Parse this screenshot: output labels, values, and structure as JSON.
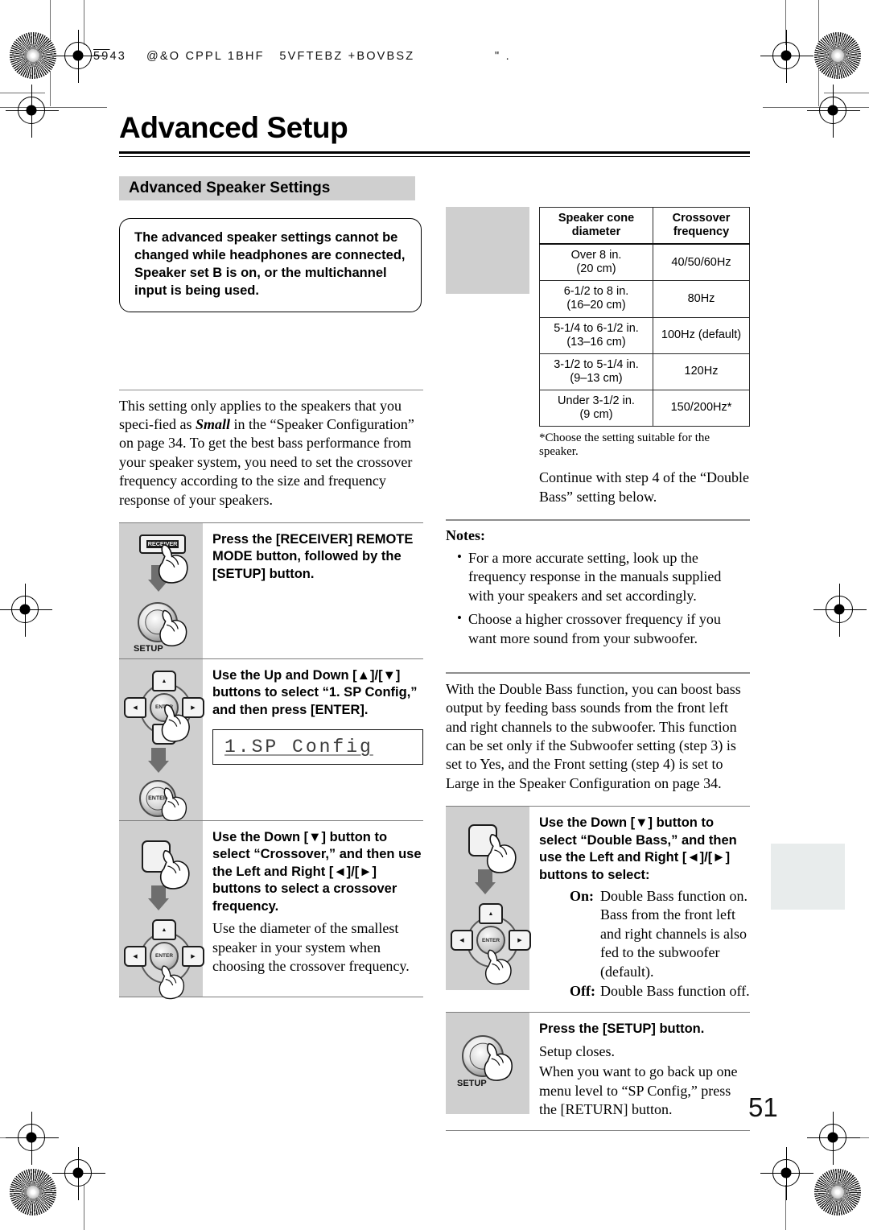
{
  "runhead": {
    "page_code": "59",
    "rest": "43    @&O CPPL 1BHF   5VFTEBZ +BOVBSZ                \" ."
  },
  "title": "Advanced Setup",
  "section": {
    "heading": "Advanced Speaker Settings"
  },
  "notice": {
    "text": "The advanced speaker settings cannot be changed while headphones are connected, Speaker set B is on, or the multichannel input is being used."
  },
  "intro": "This setting only applies to the speakers that you specified as Small in the “Speaker Configuration” on page 34. To get the best bass performance from your speaker system, you need to set the crossover frequency according to the size and frequency response of your speakers.",
  "left_steps": [
    {
      "heading": "Press the [RECEIVER] REMOTE MODE button, followed by the [SETUP] button.",
      "sub": "",
      "icons": [
        "receiver-button",
        "down-arrow",
        "setup-knob"
      ],
      "receiver_label": "RECEIVER",
      "setup_label": "SETUP"
    },
    {
      "heading": "Use the Up and Down [▲]/[▼] buttons to select “1. SP Config,” and then press [ENTER].",
      "sub": "",
      "lcd": "1.SP Config",
      "enter_label": "ENTER"
    },
    {
      "heading": "Use the Down [▼] button to select “Crossover,” and then use the Left and Right [◄]/[►] buttons to select a crossover frequency.",
      "sub": "Use the diameter of the smallest speaker in your system when choosing the crossover frequency.",
      "enter_label": "ENTER"
    }
  ],
  "table": {
    "headers": [
      "Speaker cone diameter",
      "Crossover frequency"
    ],
    "header_lines": [
      [
        "Speaker cone",
        "diameter"
      ],
      [
        "Crossover",
        "frequency"
      ]
    ],
    "rows": [
      {
        "diameter": [
          "Over 8 in.",
          "(20 cm)"
        ],
        "frequency": "40/50/60Hz"
      },
      {
        "diameter": [
          "6-1/2 to 8 in.",
          "(16–20 cm)"
        ],
        "frequency": "80Hz"
      },
      {
        "diameter": [
          "5-1/4 to 6-1/2 in.",
          "(13–16 cm)"
        ],
        "frequency": "100Hz (default)"
      },
      {
        "diameter": [
          "3-1/2 to 5-1/4 in.",
          "(9–13 cm)"
        ],
        "frequency": "120Hz"
      },
      {
        "diameter": [
          "Under 3-1/2 in.",
          "(9 cm)"
        ],
        "frequency": "150/200Hz*"
      }
    ],
    "footnote": "*Choose the setting suitable for the speaker.",
    "after": "Continue with step 4 of the “Double Bass” setting below."
  },
  "notes": {
    "heading": "Notes:",
    "items": [
      "For a more accurate setting, look up the frequency response in the manuals supplied with your speakers and set accordingly.",
      "Choose a higher crossover frequency if you want more sound from your subwoofer."
    ]
  },
  "double_bass": {
    "paragraph": "With the Double Bass function, you can boost bass output by feeding bass sounds from the front left and right channels to the subwoofer. This function can be set only if the Subwoofer setting (step 3) is set to Yes, and the Front setting (step 4) is set to Large in the Speaker Configuration on page 34."
  },
  "right_steps": [
    {
      "heading": "Use the Down [▼] button to select “Double Bass,” and then use the Left and Right [◄]/[►] buttons to select:",
      "options": [
        {
          "label": "On:",
          "text": "Double Bass function on. Bass from the front left and right channels is also fed to the subwoofer (default)."
        },
        {
          "label": "Off:",
          "text": "Double Bass function off."
        }
      ],
      "enter_label": "ENTER"
    },
    {
      "heading": "Press the [SETUP] button.",
      "sub_lines": [
        "Setup closes.",
        "When you want to go back up one menu level to “SP Config,” press the [RETURN] button."
      ],
      "setup_label": "SETUP"
    }
  ],
  "page_number": "51",
  "colors": {
    "art_panel": "#cfcfcf",
    "band": "#cfcfcf",
    "side_tab": "#e8ecec",
    "rule": "#8d8d8d"
  }
}
